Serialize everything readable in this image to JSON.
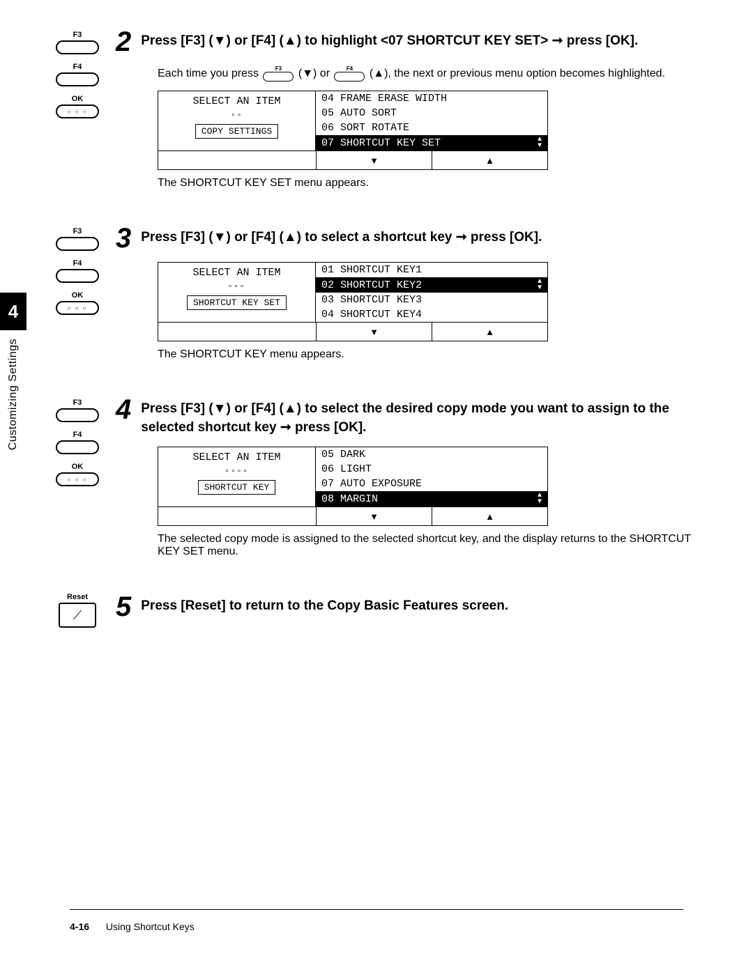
{
  "side": {
    "chapter": "4",
    "label": "Customizing Settings"
  },
  "keys": {
    "f3": "F3",
    "f4": "F4",
    "ok": "OK",
    "ok_dots": "○ ○ ○",
    "reset": "Reset",
    "reset_glyph": "⟋"
  },
  "step2": {
    "num": "2",
    "title_a": "Press [F3] (▼) or [F4] (▲) to highlight <07 SHORTCUT KEY SET> ➞ press [OK].",
    "desc_a": "Each time you press ",
    "desc_b": " (▼) or ",
    "desc_c": " (▲), the next or previous menu option becomes highlighted.",
    "lcd": {
      "left_title": "SELECT AN ITEM",
      "crumb": "▫▫",
      "box": "COPY SETTINGS",
      "rows": [
        "04 FRAME ERASE WIDTH",
        "05 AUTO SORT",
        "06 SORT ROTATE",
        "07 SHORTCUT KEY SET"
      ],
      "sel": 3
    },
    "caption": "The SHORTCUT KEY SET menu appears."
  },
  "step3": {
    "num": "3",
    "title": "Press [F3] (▼) or [F4] (▲) to select a shortcut key ➞ press [OK].",
    "lcd": {
      "left_title": "SELECT AN ITEM",
      "crumb": "▫▫▫",
      "box": "SHORTCUT KEY SET",
      "rows": [
        "01 SHORTCUT KEY1",
        "02 SHORTCUT KEY2",
        "03 SHORTCUT KEY3",
        "04 SHORTCUT KEY4"
      ],
      "sel": 1
    },
    "caption": "The SHORTCUT KEY menu appears."
  },
  "step4": {
    "num": "4",
    "title": "Press [F3] (▼) or [F4] (▲) to select the desired copy mode you want to assign to the selected shortcut key ➞ press [OK].",
    "lcd": {
      "left_title": "SELECT AN ITEM",
      "crumb": "▫▫▫▫",
      "box": "SHORTCUT KEY",
      "rows": [
        "05 DARK",
        "06 LIGHT",
        "07 AUTO EXPOSURE",
        "08 MARGIN"
      ],
      "sel": 3
    },
    "caption": "The selected copy mode is assigned to the selected shortcut key, and the display returns to the SHORTCUT KEY SET menu."
  },
  "step5": {
    "num": "5",
    "title": "Press [Reset] to return to the Copy Basic Features screen."
  },
  "nav": {
    "down": "▼",
    "up": "▲",
    "updown": "▲\n▼"
  },
  "footer": {
    "page": "4-16",
    "title": "Using Shortcut Keys"
  }
}
